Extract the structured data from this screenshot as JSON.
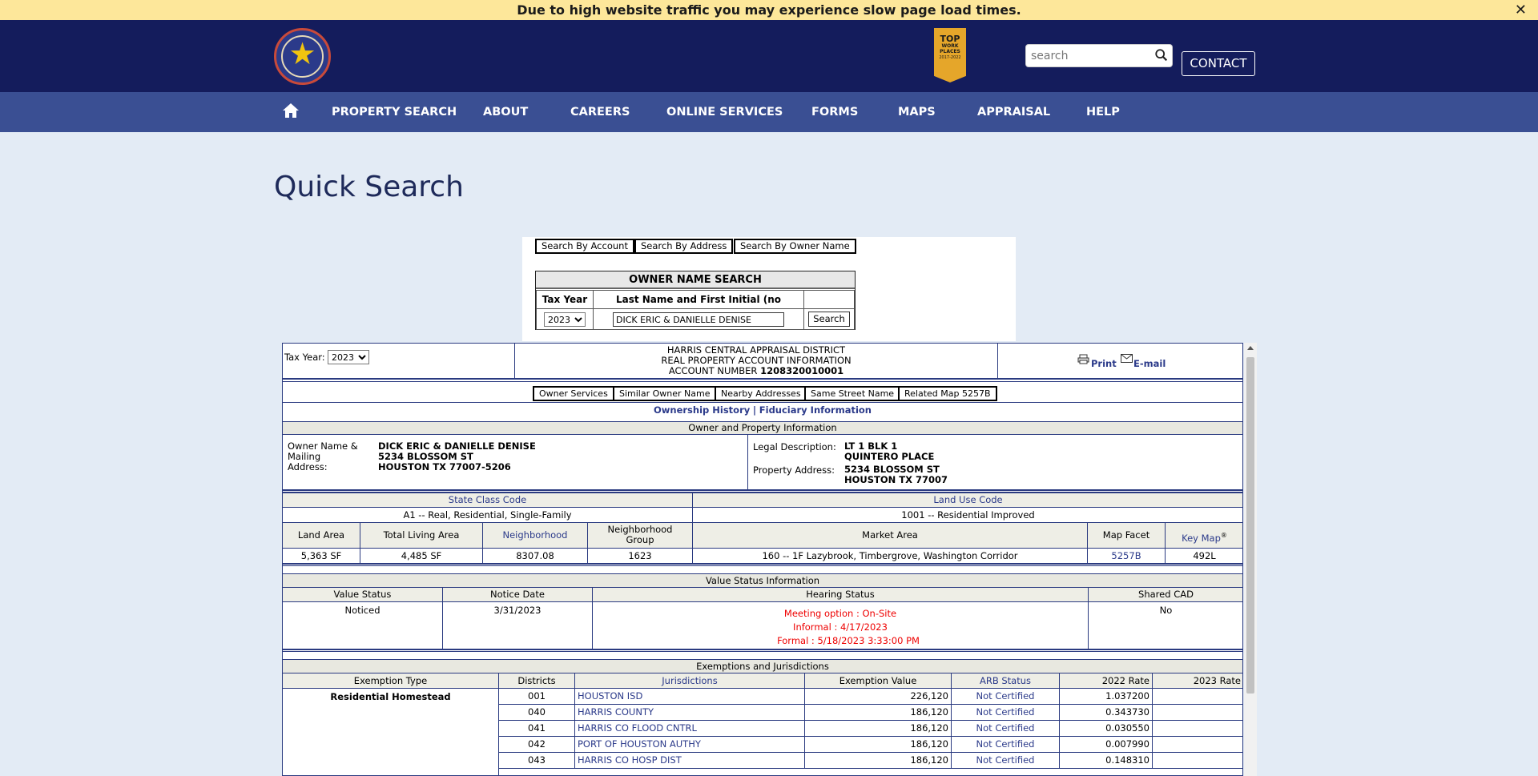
{
  "alert": {
    "text": "Due to high website traffic you may experience slow page load times.",
    "close": "✕"
  },
  "header": {
    "logo_text": "HARRIS CENTRAL APPRAISAL DISTRICT",
    "badge": {
      "line1": "TOP",
      "line2": "WORK",
      "line3": "PLACES",
      "line4": "2017-2022"
    },
    "search_placeholder": "search",
    "contact": "CONTACT"
  },
  "nav": {
    "items": [
      "PROPERTY SEARCH",
      "ABOUT",
      "CAREERS",
      "ONLINE SERVICES",
      "FORMS",
      "MAPS",
      "APPRAISAL",
      "HELP"
    ]
  },
  "page_title": "Quick Search",
  "quick_search": {
    "buttons": [
      "Search By Account",
      "Search By Address",
      "Search By Owner Name"
    ],
    "title": "OWNER NAME SEARCH",
    "col_tax_year": "Tax Year",
    "col_name": "Last Name and First Initial (no comma)",
    "tax_year": "2023",
    "name_value": "DICK ERIC & DANIELLE DENISE",
    "search_btn": "Search"
  },
  "record": {
    "tax_year_label": "Tax Year:",
    "tax_year": "2023",
    "district": "HARRIS CENTRAL APPRAISAL DISTRICT",
    "subtitle": "REAL PROPERTY ACCOUNT INFORMATION",
    "account_label": "ACCOUNT NUMBER",
    "account_number": "1208320010001",
    "print": "Print",
    "email": "E-mail",
    "tabs": [
      "Owner Services",
      "Similar Owner Name",
      "Nearby Addresses",
      "Same Street Name",
      "Related Map 5257B"
    ],
    "ownership_history": "Ownership History",
    "divider": "|",
    "fiduciary": "Fiduciary Information",
    "owner_section": "Owner and Property Information",
    "owner_label": "Owner Name & Mailing Address:",
    "owner_lines": [
      "DICK ERIC & DANIELLE DENISE",
      "5234 BLOSSOM ST",
      "HOUSTON TX 77007-5206"
    ],
    "legal_label": "Legal Description:",
    "legal_lines": [
      "LT 1 BLK 1",
      "QUINTERO PLACE"
    ],
    "property_label": "Property Address:",
    "property_lines": [
      "5234 BLOSSOM ST",
      "HOUSTON TX 77007"
    ],
    "state_class_code_label": "State Class Code",
    "state_class_code": "A1 -- Real, Residential, Single-Family",
    "land_use_code_label": "Land Use Code",
    "land_use_code": "1001 -- Residential Improved",
    "land_headers": [
      "Land Area",
      "Total Living Area",
      "Neighborhood",
      "Neighborhood Group",
      "Market Area",
      "Map Facet",
      "Key Map"
    ],
    "key_map_reg": "®",
    "land_values": [
      "5,363 SF",
      "4,485 SF",
      "8307.08",
      "1623",
      "160 -- 1F Lazybrook, Timbergrove, Washington Corridor",
      "5257B",
      "492L"
    ],
    "value_status_section": "Value Status Information",
    "value_headers": [
      "Value Status",
      "Notice Date",
      "Hearing Status",
      "Shared CAD"
    ],
    "value_status": "Noticed",
    "notice_date": "3/31/2023",
    "hearing_lines": [
      "Meeting option : On-Site",
      "Informal : 4/17/2023",
      "Formal : 5/18/2023 3:33:00 PM"
    ],
    "shared_cad": "No",
    "exemptions_section": "Exemptions and Jurisdictions",
    "exempt_headers": [
      "Exemption Type",
      "Districts",
      "Jurisdictions",
      "Exemption Value",
      "ARB Status",
      "2022 Rate",
      "2023 Rate"
    ],
    "exemption_type": "Residential Homestead",
    "jurisdictions": [
      {
        "district": "001",
        "name": "HOUSTON ISD",
        "value": "226,120",
        "arb": "Not Certified",
        "rate2022": "1.037200",
        "rate2023": ""
      },
      {
        "district": "040",
        "name": "HARRIS COUNTY",
        "value": "186,120",
        "arb": "Not Certified",
        "rate2022": "0.343730",
        "rate2023": ""
      },
      {
        "district": "041",
        "name": "HARRIS CO FLOOD CNTRL",
        "value": "186,120",
        "arb": "Not Certified",
        "rate2022": "0.030550",
        "rate2023": ""
      },
      {
        "district": "042",
        "name": "PORT OF HOUSTON AUTHY",
        "value": "186,120",
        "arb": "Not Certified",
        "rate2022": "0.007990",
        "rate2023": ""
      },
      {
        "district": "043",
        "name": "HARRIS CO HOSP DIST",
        "value": "186,120",
        "arb": "Not Certified",
        "rate2022": "0.148310",
        "rate2023": ""
      }
    ]
  }
}
